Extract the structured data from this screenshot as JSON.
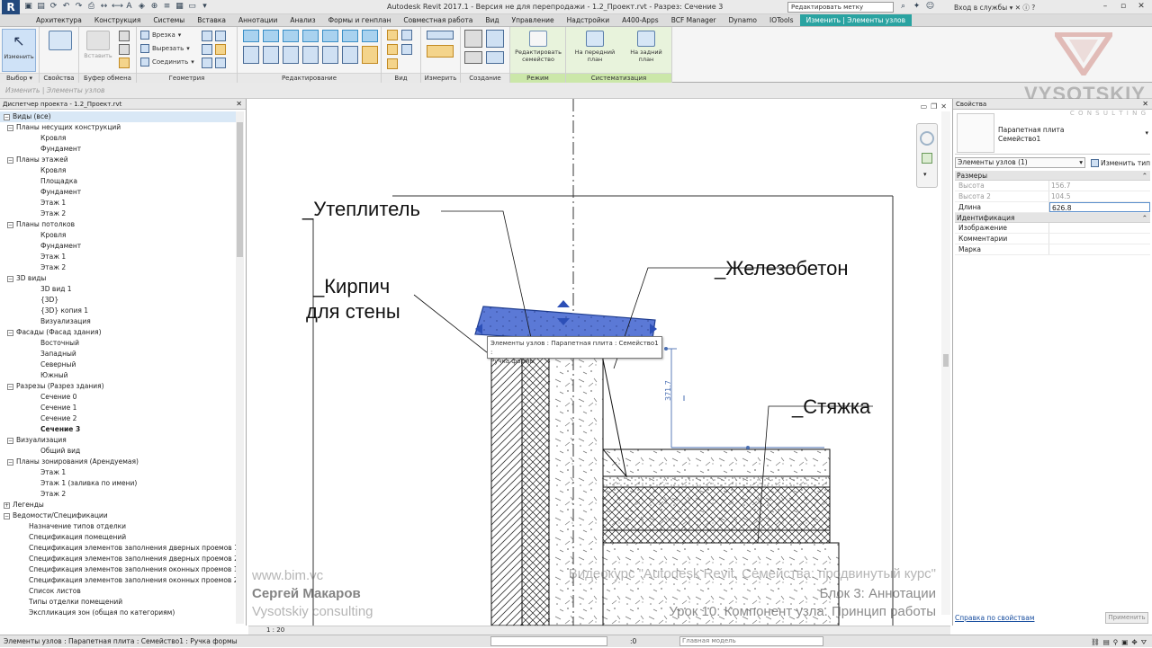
{
  "titlebar": {
    "title": "Autodesk Revit 2017.1 - Версия не для перепродажи -   1.2_Проект.rvt - Разрез: Сечение 3",
    "search_placeholder": "Редактировать метку",
    "signin": "Вход в службы",
    "logo": "R"
  },
  "tabs": [
    "Архитектура",
    "Конструкция",
    "Системы",
    "Вставка",
    "Аннотации",
    "Анализ",
    "Формы и генплан",
    "Совместная работа",
    "Вид",
    "Управление",
    "Надстройки",
    "A400-Apps",
    "BCF Manager",
    "Dynamo",
    "IOTools",
    "Изменить | Элементы узлов"
  ],
  "ribbon": {
    "modify": "Изменить",
    "select_label": "Выбор",
    "props_label": "Свойства",
    "paste": "Вставить",
    "clipboard_label": "Буфер обмена",
    "cut": "Врезка",
    "cut2": "Вырезать",
    "join": "Соединить",
    "geometry_label": "Геометрия",
    "edit_label": "Редактирование",
    "view_label": "Вид",
    "measure_label": "Измерить",
    "create_label": "Создание",
    "edit_family": "Редактировать семейство",
    "mode_label": "Режим",
    "bring_front": "На передний план",
    "send_back": "На задний план",
    "arrange_label": "Систематизация"
  },
  "options": {
    "text": "Изменить | Элементы узлов"
  },
  "browser": {
    "title": "Диспетчер проекта - 1.2_Проект.rvt",
    "nodes": [
      {
        "lvl": "l0",
        "tog": "−",
        "text": "Виды (все)",
        "sel": true
      },
      {
        "lvl": "l1",
        "tog": "−",
        "text": "Планы несущих конструкций"
      },
      {
        "lvl": "l2",
        "text": "Кровля"
      },
      {
        "lvl": "l2",
        "text": "Фундамент"
      },
      {
        "lvl": "l1",
        "tog": "−",
        "text": "Планы этажей"
      },
      {
        "lvl": "l2",
        "text": "Кровля"
      },
      {
        "lvl": "l2",
        "text": "Площадка"
      },
      {
        "lvl": "l2",
        "text": "Фундамент"
      },
      {
        "lvl": "l2",
        "text": "Этаж 1"
      },
      {
        "lvl": "l2",
        "text": "Этаж 2"
      },
      {
        "lvl": "l1",
        "tog": "−",
        "text": "Планы потолков"
      },
      {
        "lvl": "l2",
        "text": "Кровля"
      },
      {
        "lvl": "l2",
        "text": "Фундамент"
      },
      {
        "lvl": "l2",
        "text": "Этаж 1"
      },
      {
        "lvl": "l2",
        "text": "Этаж 2"
      },
      {
        "lvl": "l1",
        "tog": "−",
        "text": "3D виды"
      },
      {
        "lvl": "l2",
        "text": "3D вид 1"
      },
      {
        "lvl": "l2",
        "text": "{3D}"
      },
      {
        "lvl": "l2",
        "text": "{3D} копия 1"
      },
      {
        "lvl": "l2",
        "text": "Визуализация"
      },
      {
        "lvl": "l1",
        "tog": "−",
        "text": "Фасады (Фасад здания)"
      },
      {
        "lvl": "l2",
        "text": "Восточный"
      },
      {
        "lvl": "l2",
        "text": "Западный"
      },
      {
        "lvl": "l2",
        "text": "Северный"
      },
      {
        "lvl": "l2",
        "text": "Южный"
      },
      {
        "lvl": "l1",
        "tog": "−",
        "text": "Разрезы (Разрез здания)"
      },
      {
        "lvl": "l2",
        "text": "Сечение 0"
      },
      {
        "lvl": "l2",
        "text": "Сечение 1"
      },
      {
        "lvl": "l2",
        "text": "Сечение 2"
      },
      {
        "lvl": "l2",
        "text": "Сечение 3",
        "bold": true
      },
      {
        "lvl": "l1",
        "tog": "−",
        "text": "Визуализация"
      },
      {
        "lvl": "l2",
        "text": "Общий вид"
      },
      {
        "lvl": "l1",
        "tog": "−",
        "text": "Планы зонирования (Арендуемая)"
      },
      {
        "lvl": "l2",
        "text": "Этаж 1"
      },
      {
        "lvl": "l2",
        "text": "Этаж 1 (заливка по имени)"
      },
      {
        "lvl": "l2",
        "text": "Этаж 2"
      },
      {
        "lvl": "l0",
        "tog": "+",
        "text": "Легенды"
      },
      {
        "lvl": "l0",
        "tog": "−",
        "text": "Ведомости/Спецификации"
      },
      {
        "lvl": "l2s",
        "text": "Назначение типов отделки"
      },
      {
        "lvl": "l2s",
        "text": "Спецификация помещений"
      },
      {
        "lvl": "l2s",
        "text": "Спецификация элементов заполнения дверных проемов 1-го э"
      },
      {
        "lvl": "l2s",
        "text": "Спецификация элементов заполнения дверных проемов 2-го э"
      },
      {
        "lvl": "l2s",
        "text": "Спецификация элементов заполнения оконных проемов 1-го э"
      },
      {
        "lvl": "l2s",
        "text": "Спецификация элементов заполнения оконных проемов 2-го э"
      },
      {
        "lvl": "l2s",
        "text": "Список листов"
      },
      {
        "lvl": "l2s",
        "text": "Типы отделки помещений"
      },
      {
        "lvl": "l2s",
        "text": "Экспликация зон (общая по категориям)"
      }
    ]
  },
  "canvas": {
    "labels": {
      "insulation": "_Утеплитель",
      "brick1": "_Кирпич",
      "brick2": "для стены",
      "concrete": "_Железобетон",
      "screed": "_Стяжка"
    },
    "tooltip_line1": "Элементы узлов : Парапетная плита : Семейство1 :",
    "tooltip_line2": "Ручка формы",
    "dimension": "371.7",
    "watermark_url": "www.bim.vc",
    "watermark_author": "Сергей Макаров",
    "watermark_company": "Vysotskiy consulting",
    "course_line1": "Видеокурс \"Autodesk Revit. Семейства: продвинутый курс\"",
    "course_line2": "Блок 3: Аннотации",
    "course_line3": "Урок 10: Компонент узла. Принцип работы"
  },
  "brand": {
    "name": "VYSOTSKIY",
    "sub": "C O N S U L T I N G"
  },
  "properties": {
    "title": "Свойства",
    "type_line1": "Парапетная плита",
    "type_line2": "Семейство1",
    "instance": "Элементы узлов (1)",
    "edit_type": "Изменить тип",
    "cat_dims": "Размеры",
    "rows_dims": [
      {
        "k": "Высота",
        "v": "156.7",
        "dim": true
      },
      {
        "k": "Высота 2",
        "v": "104.5",
        "dim": true
      },
      {
        "k": "Длина",
        "v": "626.8",
        "edit": true
      }
    ],
    "cat_id": "Идентификация",
    "rows_id": [
      {
        "k": "Изображение",
        "v": ""
      },
      {
        "k": "Комментарии",
        "v": ""
      },
      {
        "k": "Марка",
        "v": ""
      }
    ],
    "help": "Справка по свойствам",
    "apply": "Применить"
  },
  "status": {
    "text": "Элементы узлов : Парапетная плита : Семейство1 : Ручка формы",
    "scale": "1 : 20",
    "zero": ":0",
    "model": "Главная модель"
  },
  "colors": {
    "accent": "#2aa3a1",
    "selection": "#5b79d6"
  }
}
